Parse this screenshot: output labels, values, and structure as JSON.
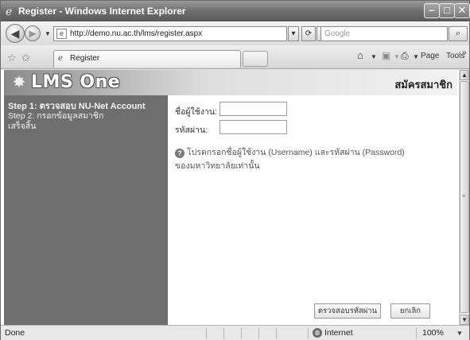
{
  "window": {
    "title": "Register - Windows Internet Explorer",
    "minimize_glyph": "–",
    "maximize_glyph": "□",
    "close_glyph": "✕"
  },
  "address_bar": {
    "url": "http://demo.nu.ac.th/lms/register.aspx",
    "search_placeholder": "Google"
  },
  "command_bar": {
    "tab_title": "Register",
    "page_label": "Page",
    "tools_label": "Tools",
    "more_glyph": "»"
  },
  "banner": {
    "logo_text": "LMS One",
    "page_heading": "สมัครสมาชิก"
  },
  "steps": {
    "step1": "Step 1: ตรวจสอบ NU-Net Account",
    "step2": "Step 2: กรอกข้อมูลสมาชิก",
    "step3": "เสร็จสิ้น"
  },
  "form": {
    "username_label": "ชื่อผู้ใช้งาน:",
    "username_value": "",
    "password_label": "รหัสผ่าน:",
    "password_value": "",
    "hint_line1": "โปรดกรอกชื่อผู้ใช้งาน (Username) และรหัสผ่าน (Password)",
    "hint_line2": "ของมหาวิทยาลัยเท่านั้น",
    "verify_button": "ตรวจสอบรหัสผ่าน",
    "cancel_button": "ยกเลิก"
  },
  "status_bar": {
    "status": "Done",
    "zone": "Internet",
    "zoom": "100%"
  },
  "icons": {
    "ie": "ie-icon",
    "back": "back-arrow-icon",
    "forward": "forward-arrow-icon",
    "refresh": "refresh-icon",
    "stop": "stop-icon",
    "search": "search-icon",
    "favorites": "favorites-star-icon",
    "add_favorites": "add-favorites-icon",
    "home": "home-icon",
    "feeds": "feeds-icon",
    "print": "print-icon",
    "hint": "help-icon",
    "internet_zone": "globe-icon"
  }
}
